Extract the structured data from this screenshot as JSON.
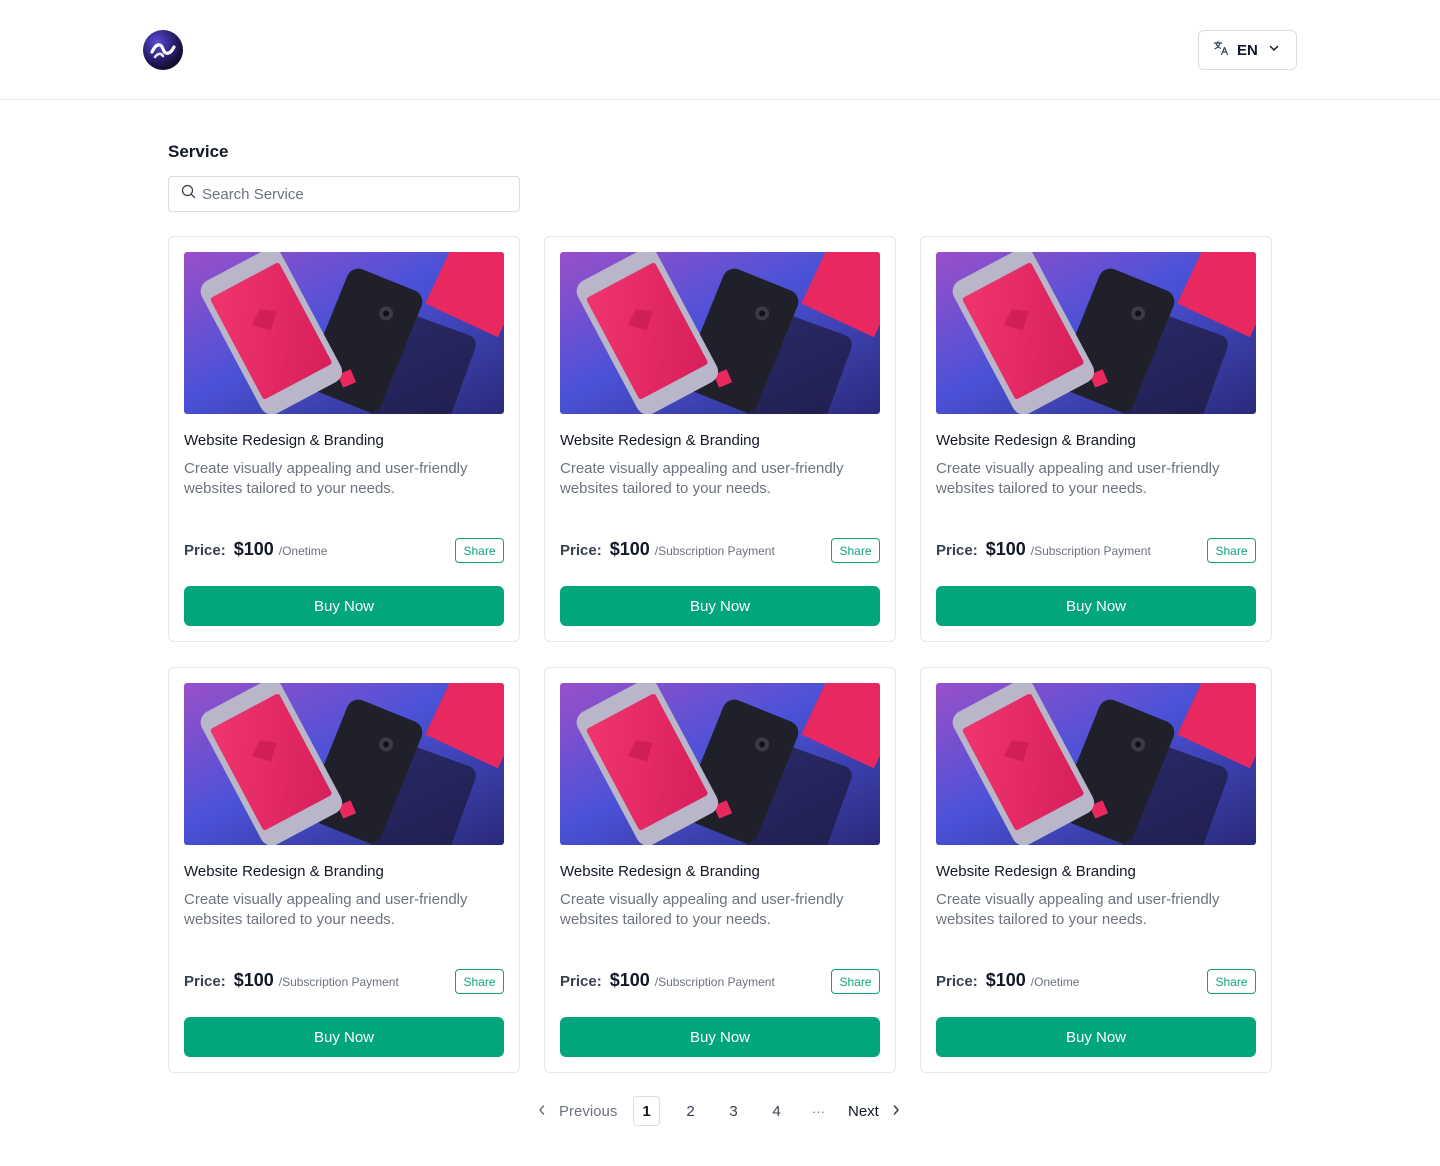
{
  "header": {
    "logo_icon": "wave-logo-icon",
    "language": {
      "label": "EN",
      "icon": "translate-icon",
      "chevron": "chevron-down-icon"
    }
  },
  "page": {
    "title": "Service",
    "search": {
      "placeholder": "Search Service",
      "value": "",
      "icon": "search-icon"
    }
  },
  "services": [
    {
      "title": "Website Redesign & Branding",
      "description": "Create visually appealing and user-friendly websites tailored to your needs.",
      "price_label": "Price:",
      "price": "$100",
      "period": "/Onetime",
      "share_label": "Share",
      "buy_label": "Buy Now"
    },
    {
      "title": "Website Redesign & Branding",
      "description": "Create visually appealing and user-friendly websites tailored to your needs.",
      "price_label": "Price:",
      "price": "$100",
      "period": "/Subscription Payment",
      "share_label": "Share",
      "buy_label": "Buy Now"
    },
    {
      "title": "Website Redesign & Branding",
      "description": "Create visually appealing and user-friendly websites tailored to your needs.",
      "price_label": "Price:",
      "price": "$100",
      "period": "/Subscription Payment",
      "share_label": "Share",
      "buy_label": "Buy Now"
    },
    {
      "title": "Website Redesign & Branding",
      "description": "Create visually appealing and user-friendly websites tailored to your needs.",
      "price_label": "Price:",
      "price": "$100",
      "period": "/Subscription Payment",
      "share_label": "Share",
      "buy_label": "Buy Now"
    },
    {
      "title": "Website Redesign & Branding",
      "description": "Create visually appealing and user-friendly websites tailored to your needs.",
      "price_label": "Price:",
      "price": "$100",
      "period": "/Subscription Payment",
      "share_label": "Share",
      "buy_label": "Buy Now"
    },
    {
      "title": "Website Redesign & Branding",
      "description": "Create visually appealing and user-friendly websites tailored to your needs.",
      "price_label": "Price:",
      "price": "$100",
      "period": "/Onetime",
      "share_label": "Share",
      "buy_label": "Buy Now"
    }
  ],
  "pagination": {
    "previous_label": "Previous",
    "next_label": "Next",
    "pages": [
      "1",
      "2",
      "3",
      "4"
    ],
    "ellipsis": "···",
    "current": "1"
  },
  "colors": {
    "primary": "#03a57c",
    "share_border": "#10a37f",
    "border": "#e3e6ea",
    "muted_text": "#6b7280"
  }
}
